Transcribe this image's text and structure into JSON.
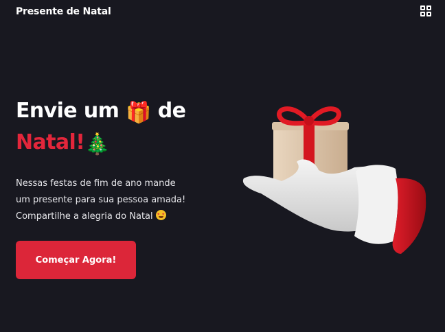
{
  "header": {
    "brand": "Presente de Natal",
    "menu_icon": "grid-icon"
  },
  "hero": {
    "title_line1_text": "Envie um",
    "title_line1_emoji": "🎁",
    "title_line1_suffix": "de",
    "title_line2_text": "Natal!",
    "title_line2_emoji": "🎄",
    "description": "Nessas festas de fim de ano mande\num presente para sua pessoa amada!\nCompartilhe a alegria do Natal",
    "description_emoji": "star-struck-emoji",
    "cta_label": "Começar Agora!"
  },
  "illustration": {
    "icon": "santa-hand-holding-gift-icon"
  },
  "colors": {
    "background": "#181820",
    "accent": "#dc2639",
    "text": "#ffffff"
  }
}
